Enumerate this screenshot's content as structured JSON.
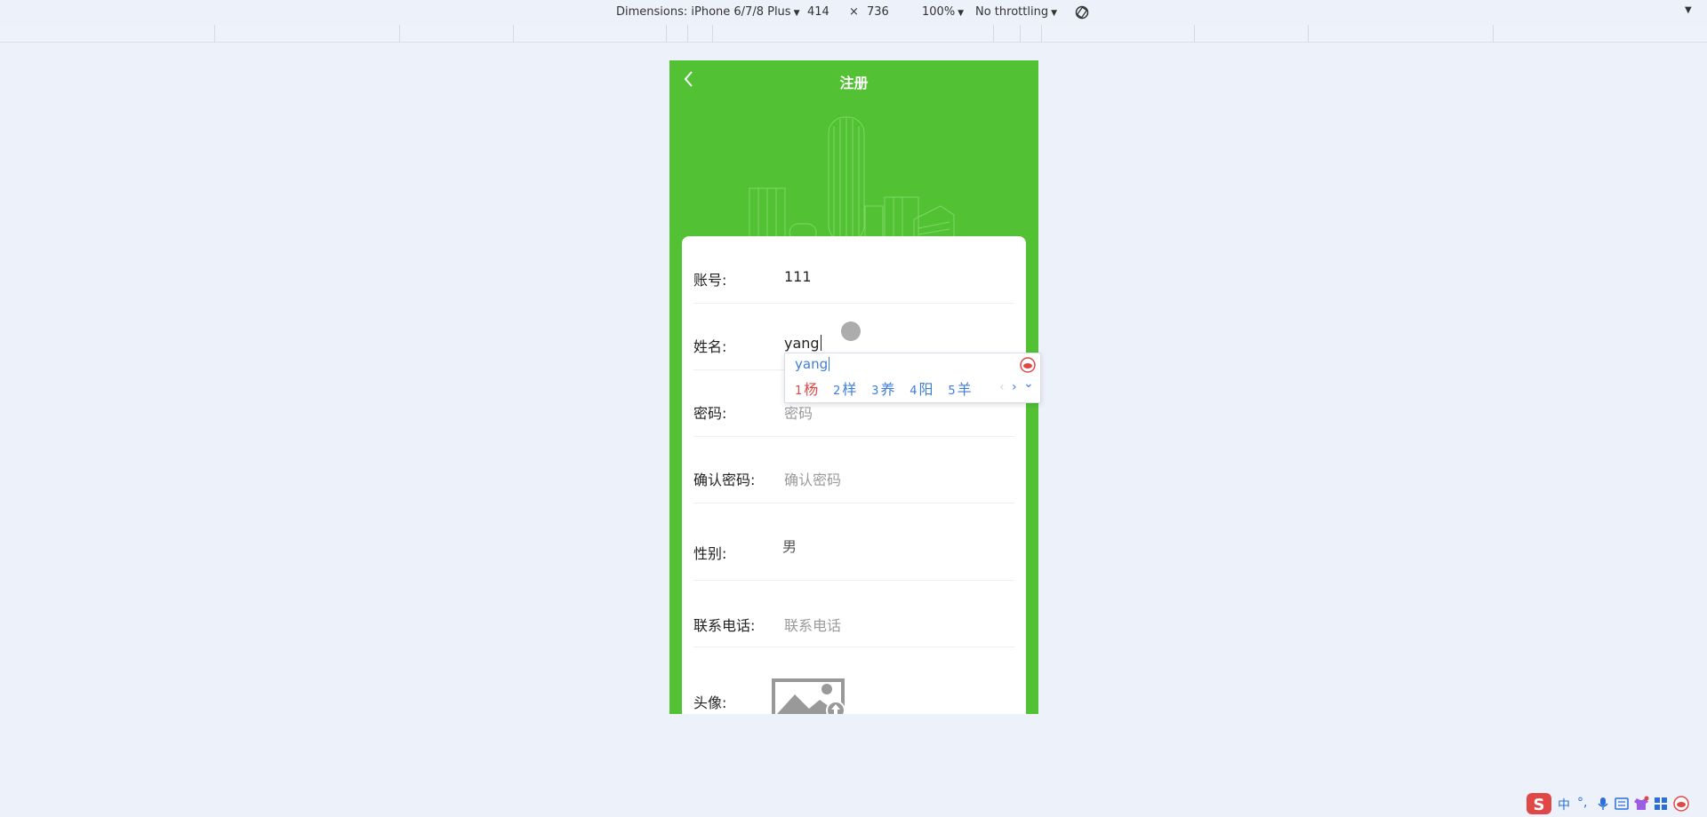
{
  "devtools": {
    "dimensions_label": "Dimensions: iPhone 6/7/8 Plus",
    "width": "414",
    "times": "×",
    "height": "736",
    "zoom": "100%",
    "throttling": "No throttling"
  },
  "page": {
    "title": "注册"
  },
  "form": {
    "account": {
      "label": "账号:",
      "value": "111"
    },
    "name": {
      "label": "姓名:",
      "value": "yang"
    },
    "password": {
      "label": "密码:",
      "placeholder": "密码"
    },
    "confirm_password": {
      "label": "确认密码:",
      "placeholder": "确认密码"
    },
    "gender": {
      "label": "性别:",
      "value": "男"
    },
    "phone": {
      "label": "联系电话:",
      "placeholder": "联系电话"
    },
    "avatar": {
      "label": "头像:"
    }
  },
  "ime": {
    "composition": "yang",
    "candidates": [
      {
        "num": "1",
        "text": "杨"
      },
      {
        "num": "2",
        "text": "样"
      },
      {
        "num": "3",
        "text": "养"
      },
      {
        "num": "4",
        "text": "阳"
      },
      {
        "num": "5",
        "text": "羊"
      }
    ],
    "prev": "‹",
    "next": "›",
    "expand": "⌄"
  },
  "tray": {
    "lang": "中",
    "punct": "°,"
  },
  "colors": {
    "brand_green": "#52c234",
    "ime_blue": "#3f7ed8",
    "ime_first": "#e04848"
  }
}
